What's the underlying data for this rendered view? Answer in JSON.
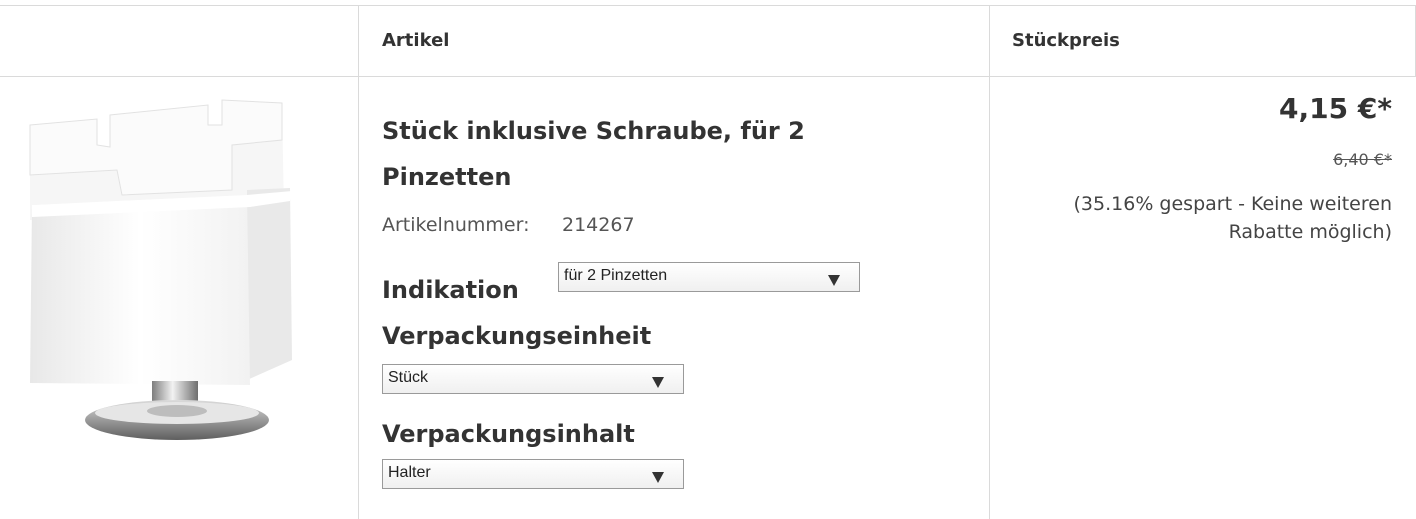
{
  "table": {
    "headers": {
      "image": "",
      "artikel": "Artikel",
      "preis": "Stückpreis"
    }
  },
  "product": {
    "image_icon": "white-tweezer-holder-block-with-screw",
    "title": "Stück inklusive Schraube, für 2 Pinzetten",
    "artikelnummer_label": "Artikelnummer:",
    "artikelnummer_value": "214267",
    "options": {
      "indikation": {
        "label": "Indikation",
        "selected": "für 2 Pinzetten"
      },
      "verpackungseinheit": {
        "label": "Verpackungseinheit",
        "selected": "Stück"
      },
      "verpackungsinhalt": {
        "label": "Verpackungsinhalt",
        "selected": "Halter"
      }
    },
    "price": {
      "current": "4,15 €*",
      "old": "6,40 €*",
      "saved_note": "(35.16% gespart - Keine weiteren Rabatte möglich)"
    }
  },
  "colors": {
    "border": "#dadada",
    "text": "#333333"
  }
}
